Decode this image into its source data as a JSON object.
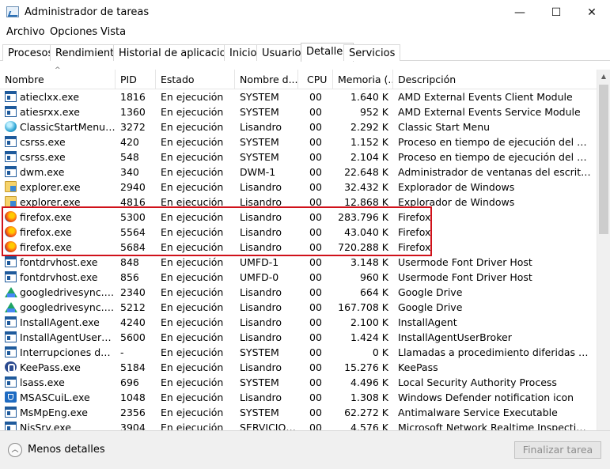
{
  "window": {
    "title": "Administrador de tareas",
    "icon": "task-manager-icon",
    "controls": {
      "minimize": "—",
      "maximize": "☐",
      "close": "✕"
    }
  },
  "menu": [
    "Archivo",
    "Opciones",
    "Vista"
  ],
  "tabs": [
    {
      "label": "Procesos",
      "active": false
    },
    {
      "label": "Rendimiento",
      "active": false
    },
    {
      "label": "Historial de aplicaciones",
      "active": false
    },
    {
      "label": "Inicio",
      "active": false
    },
    {
      "label": "Usuarios",
      "active": false
    },
    {
      "label": "Detalles",
      "active": true
    },
    {
      "label": "Servicios",
      "active": false
    }
  ],
  "table": {
    "sort_indicator": "^",
    "columns": [
      "Nombre",
      "PID",
      "Estado",
      "Nombre d...",
      "CPU",
      "Memoria (...",
      "Descripción"
    ],
    "rows": [
      {
        "icon": "win",
        "name": "atieclxx.exe",
        "pid": "1816",
        "estado": "En ejecución",
        "user": "SYSTEM",
        "cpu": "00",
        "mem": "1.640 K",
        "desc": "AMD External Events Client Module"
      },
      {
        "icon": "win",
        "name": "atiesrxx.exe",
        "pid": "1360",
        "estado": "En ejecución",
        "user": "SYSTEM",
        "cpu": "00",
        "mem": "952 K",
        "desc": "AMD External Events Service Module"
      },
      {
        "icon": "startmenu",
        "name": "ClassicStartMenu.exe",
        "pid": "3272",
        "estado": "En ejecución",
        "user": "Lisandro",
        "cpu": "00",
        "mem": "2.292 K",
        "desc": "Classic Start Menu"
      },
      {
        "icon": "win",
        "name": "csrss.exe",
        "pid": "420",
        "estado": "En ejecución",
        "user": "SYSTEM",
        "cpu": "00",
        "mem": "1.152 K",
        "desc": "Proceso en tiempo de ejecución del cliente-..."
      },
      {
        "icon": "win",
        "name": "csrss.exe",
        "pid": "548",
        "estado": "En ejecución",
        "user": "SYSTEM",
        "cpu": "00",
        "mem": "2.104 K",
        "desc": "Proceso en tiempo de ejecución del cliente-..."
      },
      {
        "icon": "win",
        "name": "dwm.exe",
        "pid": "340",
        "estado": "En ejecución",
        "user": "DWM-1",
        "cpu": "00",
        "mem": "22.648 K",
        "desc": "Administrador de ventanas del escritorio"
      },
      {
        "icon": "folder",
        "name": "explorer.exe",
        "pid": "2940",
        "estado": "En ejecución",
        "user": "Lisandro",
        "cpu": "00",
        "mem": "32.432 K",
        "desc": "Explorador de Windows"
      },
      {
        "icon": "folder",
        "name": "explorer.exe",
        "pid": "4816",
        "estado": "En ejecución",
        "user": "Lisandro",
        "cpu": "00",
        "mem": "12.868 K",
        "desc": "Explorador de Windows"
      },
      {
        "icon": "firefox",
        "name": "firefox.exe",
        "pid": "5300",
        "estado": "En ejecución",
        "user": "Lisandro",
        "cpu": "00",
        "mem": "283.796 K",
        "desc": "Firefox"
      },
      {
        "icon": "firefox",
        "name": "firefox.exe",
        "pid": "5564",
        "estado": "En ejecución",
        "user": "Lisandro",
        "cpu": "00",
        "mem": "43.040 K",
        "desc": "Firefox"
      },
      {
        "icon": "firefox",
        "name": "firefox.exe",
        "pid": "5684",
        "estado": "En ejecución",
        "user": "Lisandro",
        "cpu": "00",
        "mem": "720.288 K",
        "desc": "Firefox"
      },
      {
        "icon": "win",
        "name": "fontdrvhost.exe",
        "pid": "848",
        "estado": "En ejecución",
        "user": "UMFD-1",
        "cpu": "00",
        "mem": "3.148 K",
        "desc": "Usermode Font Driver Host"
      },
      {
        "icon": "win",
        "name": "fontdrvhost.exe",
        "pid": "856",
        "estado": "En ejecución",
        "user": "UMFD-0",
        "cpu": "00",
        "mem": "960 K",
        "desc": "Usermode Font Driver Host"
      },
      {
        "icon": "gdrive",
        "name": "googledrivesync.exe",
        "pid": "2340",
        "estado": "En ejecución",
        "user": "Lisandro",
        "cpu": "00",
        "mem": "664 K",
        "desc": "Google Drive"
      },
      {
        "icon": "gdrive",
        "name": "googledrivesync.exe",
        "pid": "5212",
        "estado": "En ejecución",
        "user": "Lisandro",
        "cpu": "00",
        "mem": "167.708 K",
        "desc": "Google Drive"
      },
      {
        "icon": "win",
        "name": "InstallAgent.exe",
        "pid": "4240",
        "estado": "En ejecución",
        "user": "Lisandro",
        "cpu": "00",
        "mem": "2.100 K",
        "desc": "InstallAgent"
      },
      {
        "icon": "win",
        "name": "InstallAgentUserBrok...",
        "pid": "5600",
        "estado": "En ejecución",
        "user": "Lisandro",
        "cpu": "00",
        "mem": "1.424 K",
        "desc": "InstallAgentUserBroker"
      },
      {
        "icon": "win",
        "name": "Interrupciones del si...",
        "pid": "-",
        "estado": "En ejecución",
        "user": "SYSTEM",
        "cpu": "00",
        "mem": "0 K",
        "desc": "Llamadas a procedimiento diferidas y rutina..."
      },
      {
        "icon": "keepass",
        "name": "KeePass.exe",
        "pid": "5184",
        "estado": "En ejecución",
        "user": "Lisandro",
        "cpu": "00",
        "mem": "15.276 K",
        "desc": "KeePass"
      },
      {
        "icon": "win",
        "name": "lsass.exe",
        "pid": "696",
        "estado": "En ejecución",
        "user": "SYSTEM",
        "cpu": "00",
        "mem": "4.496 K",
        "desc": "Local Security Authority Process"
      },
      {
        "icon": "shield",
        "name": "MSASCuiL.exe",
        "pid": "1048",
        "estado": "En ejecución",
        "user": "Lisandro",
        "cpu": "00",
        "mem": "1.308 K",
        "desc": "Windows Defender notification icon"
      },
      {
        "icon": "win",
        "name": "MsMpEng.exe",
        "pid": "2356",
        "estado": "En ejecución",
        "user": "SYSTEM",
        "cpu": "00",
        "mem": "62.272 K",
        "desc": "Antimalware Service Executable"
      },
      {
        "icon": "win",
        "name": "NisSrv.exe",
        "pid": "3904",
        "estado": "En ejecución",
        "user": "SERVICIO ...",
        "cpu": "00",
        "mem": "4.576 K",
        "desc": "Microsoft Network Realtime Inspection Serv..."
      }
    ]
  },
  "highlight_color": "#d0111a",
  "footer": {
    "less_details_icon": "︿",
    "less_details": "Menos detalles",
    "end_task": "Finalizar tarea"
  },
  "scrollbar": {
    "up_arrow": "▲"
  }
}
